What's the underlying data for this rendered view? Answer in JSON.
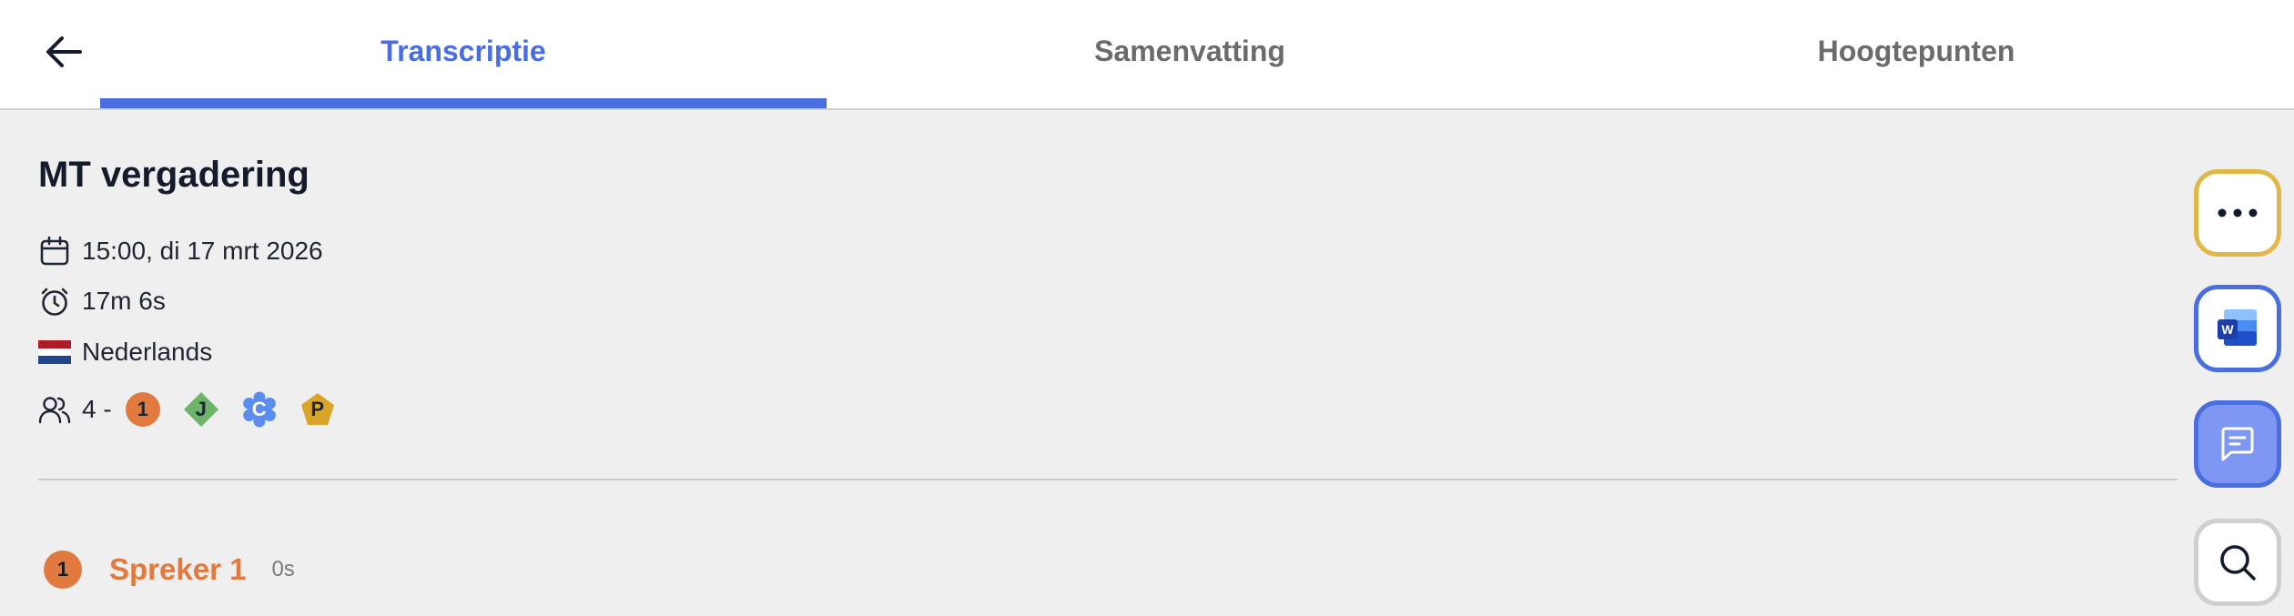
{
  "tabs": [
    {
      "label": "Transcriptie",
      "active": true
    },
    {
      "label": "Samenvatting",
      "active": false
    },
    {
      "label": "Hoogtepunten",
      "active": false
    }
  ],
  "meeting": {
    "title": "MT vergadering",
    "datetime": "15:00, di 17 mrt 2026",
    "duration": "17m 6s",
    "language": "Nederlands",
    "participants_prefix": "4 -",
    "participants": [
      {
        "initial": "1",
        "shape": "circle",
        "color": "#e07a3f"
      },
      {
        "initial": "J",
        "shape": "diamond",
        "color": "#6db36a"
      },
      {
        "initial": "C",
        "shape": "flower",
        "color": "#5b8def"
      },
      {
        "initial": "P",
        "shape": "pentagon",
        "color": "#d9a42a"
      }
    ]
  },
  "transcript": [
    {
      "speaker_number": "1",
      "speaker": "Spreker 1",
      "time": "0s"
    }
  ],
  "icons": {
    "back": "arrow-left-icon",
    "date": "calendar-icon",
    "duration": "stopwatch-icon",
    "language": "dutch-flag-icon",
    "participants": "users-icon",
    "more": "more-dots-icon",
    "word": "word-export-icon",
    "chat": "chat-icon",
    "search": "search-icon"
  },
  "colors": {
    "accent": "#4a6ee0",
    "speaker1": "#e07a3f",
    "more_border": "#e0b84a",
    "chat_fill": "#7e97f3"
  }
}
